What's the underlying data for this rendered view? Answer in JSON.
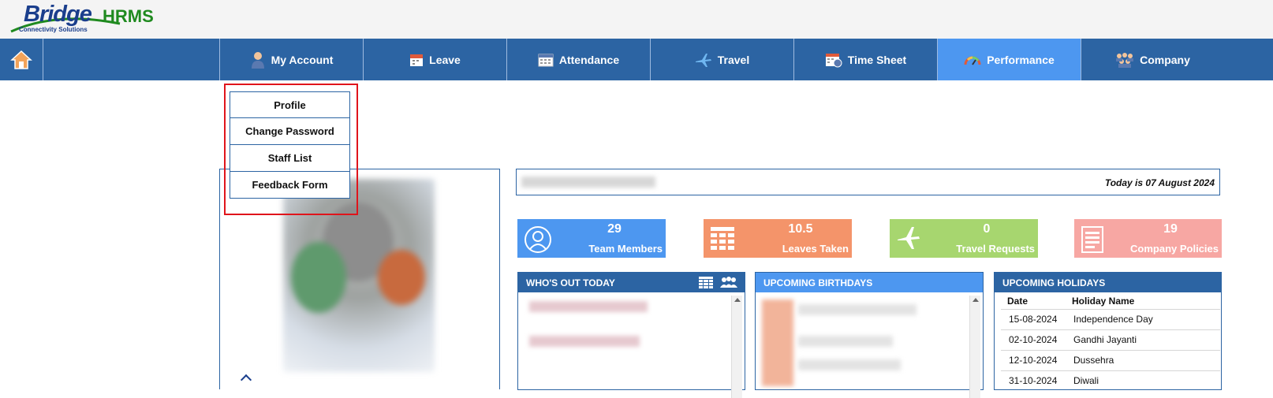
{
  "app": {
    "brand": "Bridge",
    "product": "HRMS",
    "tagline": "Connectivity Solutions"
  },
  "nav": {
    "home_icon": "home-icon",
    "items": [
      {
        "label": "My Account",
        "icon": "user-icon"
      },
      {
        "label": "Leave",
        "icon": "calendar-icon"
      },
      {
        "label": "Attendance",
        "icon": "calendar-grid-icon"
      },
      {
        "label": "Travel",
        "icon": "airplane-icon"
      },
      {
        "label": "Time Sheet",
        "icon": "timesheet-icon"
      },
      {
        "label": "Performance",
        "icon": "gauge-icon",
        "active": true
      },
      {
        "label": "Company",
        "icon": "team-icon"
      }
    ]
  },
  "dropdown": {
    "items": [
      {
        "label": "Profile"
      },
      {
        "label": "Change Password"
      },
      {
        "label": "Staff List"
      },
      {
        "label": "Feedback Form"
      }
    ]
  },
  "greeting": {
    "today": "Today is 07 August 2024"
  },
  "stats": [
    {
      "value": "29",
      "label": "Team Members",
      "color": "#4d97f0",
      "icon": "user-circle-icon"
    },
    {
      "value": "10.5",
      "label": "Leaves Taken",
      "color": "#f4946a",
      "icon": "table-icon"
    },
    {
      "value": "0",
      "label": "Travel Requests",
      "color": "#a7d66f",
      "icon": "airplane-icon"
    },
    {
      "value": "19",
      "label": "Company Policies",
      "color": "#f7a7a3",
      "icon": "document-icon"
    }
  ],
  "panels": {
    "whos_out": {
      "title": "WHO'S OUT TODAY"
    },
    "birthdays": {
      "title": "UPCOMING BIRTHDAYS"
    },
    "holidays": {
      "title": "UPCOMING HOLIDAYS",
      "columns": [
        "Date",
        "Holiday Name"
      ],
      "rows": [
        {
          "date": "15-08-2024",
          "name": "Independence Day"
        },
        {
          "date": "02-10-2024",
          "name": "Gandhi Jayanti"
        },
        {
          "date": "12-10-2024",
          "name": "Dussehra"
        },
        {
          "date": "31-10-2024",
          "name": "Diwali"
        }
      ]
    }
  },
  "colors": {
    "nav": "#2c64a3",
    "nav_active": "#4d97f0",
    "highlight": "#e0141b"
  }
}
